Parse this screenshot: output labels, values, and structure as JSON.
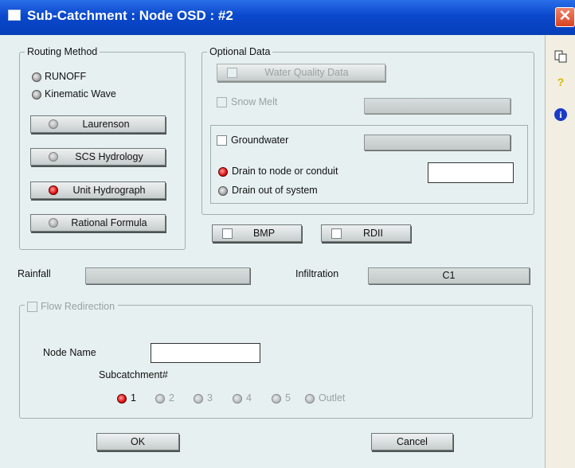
{
  "window": {
    "title": "Sub-Catchment : Node OSD : #2",
    "close_glyph": "✕"
  },
  "sidebar": {
    "icons": [
      "copy-icon",
      "help-icon",
      "info-icon"
    ],
    "help_glyph": "?",
    "info_glyph": "i"
  },
  "routing": {
    "legend": "Routing Method",
    "runoff": "RUNOFF",
    "kinematic": "Kinematic Wave",
    "buttons": [
      "Laurenson",
      "SCS Hydrology",
      "Unit Hydrograph",
      "Rational Formula"
    ],
    "selected": "Unit Hydrograph"
  },
  "optional": {
    "legend": "Optional Data",
    "water_quality": "Water Quality Data",
    "snow_melt": "Snow Melt",
    "groundwater": "Groundwater",
    "drain_node": "Drain to node or conduit",
    "drain_out": "Drain out of system"
  },
  "bmp": "BMP",
  "rdii": "RDII",
  "rainfall": {
    "label": "Rainfall",
    "value": ""
  },
  "infiltration": {
    "label": "Infiltration",
    "value": "C1"
  },
  "redirection": {
    "legend": "Flow Redirection",
    "node_name_label": "Node Name",
    "node_name_value": "",
    "subcatchment_label": "Subcatchment#",
    "options": [
      "1",
      "2",
      "3",
      "4",
      "5",
      "Outlet"
    ],
    "selected": "1"
  },
  "footer": {
    "ok": "OK",
    "cancel": "Cancel"
  },
  "colors": {
    "title_bar": "#0a48cc",
    "panel": "#e6f0f0",
    "selected_radio": "#e01010"
  }
}
